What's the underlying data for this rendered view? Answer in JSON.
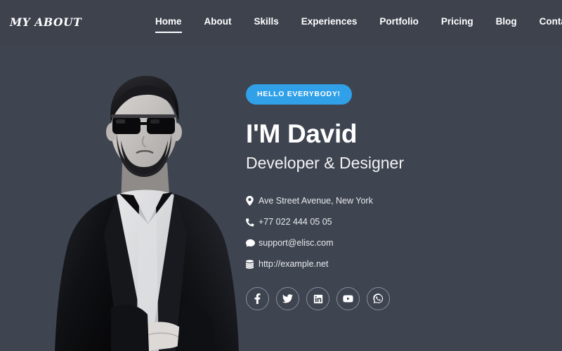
{
  "header": {
    "logo": "MY ABOUT",
    "nav": [
      {
        "label": "Home",
        "active": true,
        "icon": "nav-link"
      },
      {
        "label": "About",
        "active": false,
        "icon": "nav-link"
      },
      {
        "label": "Skills",
        "active": false,
        "icon": "nav-link"
      },
      {
        "label": "Experiences",
        "active": false,
        "icon": "nav-link"
      },
      {
        "label": "Portfolio",
        "active": false,
        "icon": "nav-link"
      },
      {
        "label": "Pricing",
        "active": false,
        "icon": "nav-link"
      },
      {
        "label": "Blog",
        "active": false,
        "icon": "nav-link"
      },
      {
        "label": "Contact",
        "active": false,
        "icon": "nav-link"
      }
    ]
  },
  "hero": {
    "badge": "HELLO EVERYBODY!",
    "name": "I'M David",
    "role": "Developer & Designer",
    "photo_alt": "portrait-photo-black-and-white-man-in-sunglasses-and-blazer"
  },
  "contact": [
    {
      "icon": "map-pin-icon",
      "text": "Ave Street Avenue, New York"
    },
    {
      "icon": "phone-icon",
      "text": "+77 022 444 05 05"
    },
    {
      "icon": "comment-icon",
      "text": "support@elisc.com"
    },
    {
      "icon": "database-icon",
      "text": "http://example.net"
    }
  ],
  "social": [
    {
      "icon": "facebook-icon",
      "label": "Facebook"
    },
    {
      "icon": "twitter-icon",
      "label": "Twitter"
    },
    {
      "icon": "linkedin-icon",
      "label": "LinkedIn"
    },
    {
      "icon": "youtube-icon",
      "label": "YouTube"
    },
    {
      "icon": "whatsapp-icon",
      "label": "WhatsApp"
    }
  ],
  "colors": {
    "background": "#3e4450",
    "header_background": "#3d424d",
    "accent_blue": "#30a0e8",
    "text_primary": "#ffffff",
    "social_border": "#8b8f98"
  }
}
